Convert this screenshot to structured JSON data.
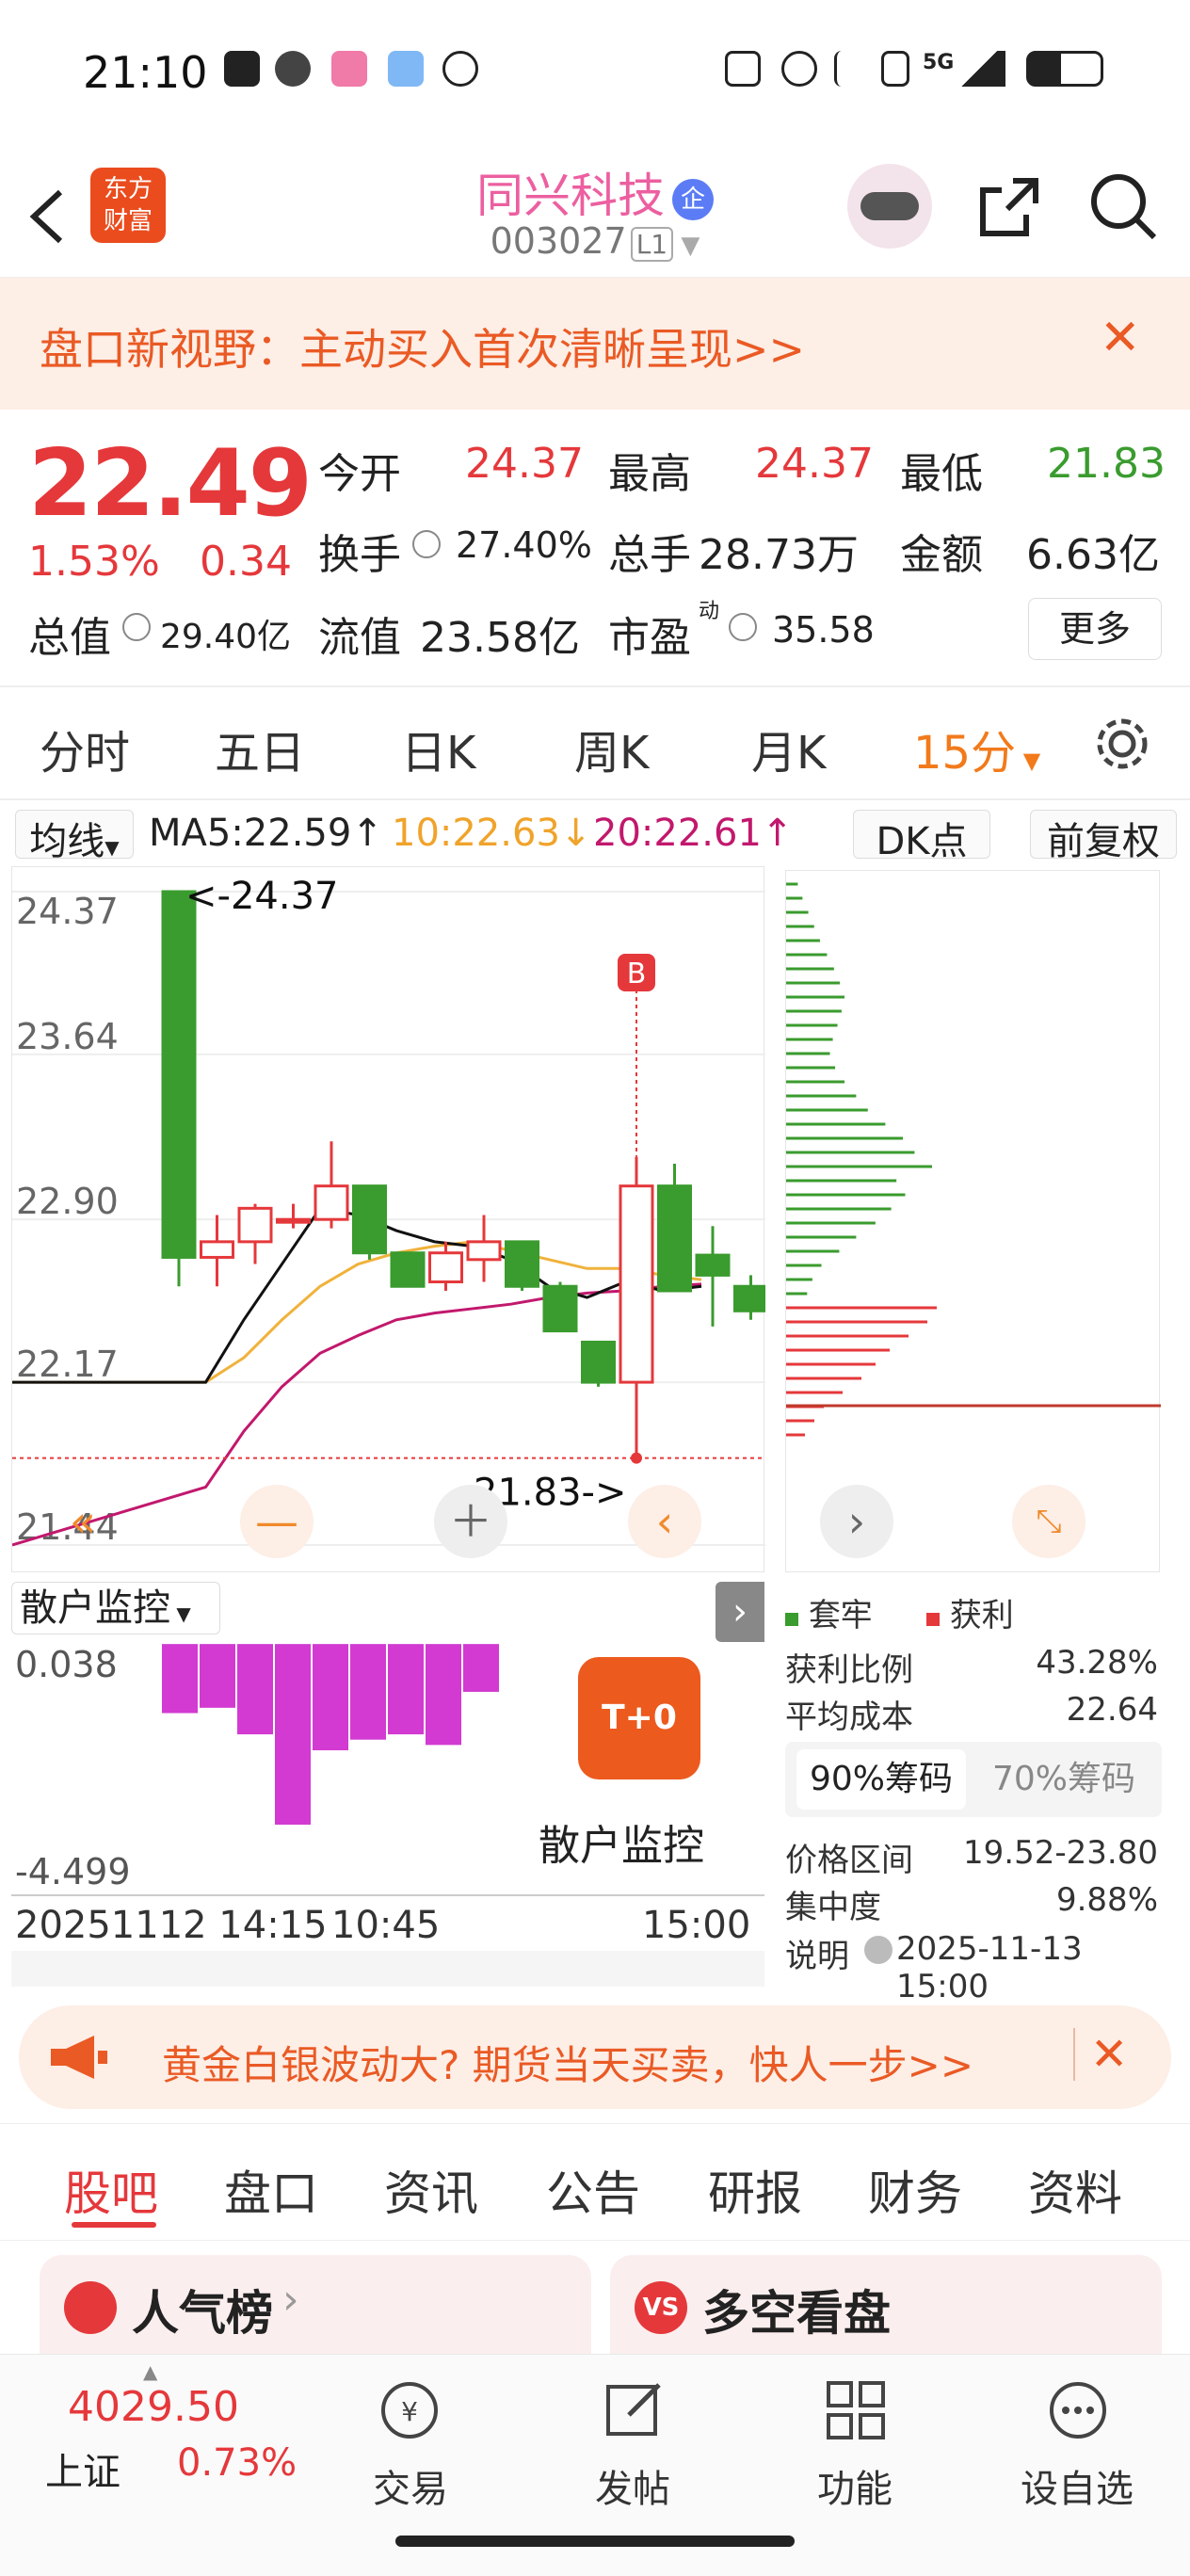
{
  "status_bar": {
    "time": "21:10",
    "network": "5G",
    "icons": [
      "upload-icon",
      "wechat-icon",
      "bilibili-icon",
      "weather-icon",
      "hand-icon",
      "nfc-icon",
      "alarm-icon",
      "bluetooth-icon",
      "vibrate-icon",
      "signal-icon",
      "battery-icon"
    ]
  },
  "header": {
    "stock_name": "同兴科技",
    "badge": "企",
    "stock_code": "003027",
    "level": "L1",
    "logo_line1": "东方",
    "logo_line2": "财富"
  },
  "banner": {
    "text": "盘口新视野：主动买入首次清晰呈现>>",
    "close": "✕"
  },
  "quote": {
    "price": "22.49",
    "change_pct": "1.53%",
    "change": "0.34",
    "open_label": "今开",
    "open": "24.37",
    "high_label": "最高",
    "high": "24.37",
    "low_label": "最低",
    "low": "21.83",
    "turnover_label": "换手",
    "turnover": "27.40%",
    "volume_label": "总手",
    "volume": "28.73万",
    "amount_label": "金额",
    "amount": "6.63亿",
    "mktcap_label": "总值",
    "mktcap": "29.40亿",
    "float_label": "流值",
    "float": "23.58亿",
    "pe_label": "市盈",
    "pe_sup": "动",
    "pe": "35.58",
    "more": "更多"
  },
  "kline_tabs": [
    "分时",
    "五日",
    "日K",
    "周K",
    "月K"
  ],
  "kline_active": "15分",
  "ma_row": {
    "selector": "均线",
    "ma5": "MA5:22.59↑",
    "ma10": "10:22.63↓",
    "ma20": "20:22.61↑",
    "dk": "DK点",
    "adjust": "前复权"
  },
  "chart_data": {
    "type": "candlestick",
    "y_ticks": [
      "24.37",
      "23.64",
      "22.90",
      "22.17",
      "21.44"
    ],
    "ylim": [
      21.44,
      24.37
    ],
    "high_marker": "<-24.37",
    "low_marker": "21.83->",
    "buy_marker": "B",
    "x_labels": [
      "20251112 14:15",
      "10:45",
      "15:00"
    ],
    "candles": [
      {
        "o": 24.37,
        "h": 24.37,
        "l": 22.6,
        "c": 22.73
      },
      {
        "o": 22.73,
        "h": 22.92,
        "l": 22.6,
        "c": 22.8
      },
      {
        "o": 22.8,
        "h": 22.97,
        "l": 22.7,
        "c": 22.95
      },
      {
        "o": 22.9,
        "h": 22.97,
        "l": 22.86,
        "c": 22.9
      },
      {
        "o": 22.9,
        "h": 23.25,
        "l": 22.86,
        "c": 23.05
      },
      {
        "o": 23.05,
        "h": 23.05,
        "l": 22.72,
        "c": 22.75
      },
      {
        "o": 22.75,
        "h": 22.75,
        "l": 22.6,
        "c": 22.6
      },
      {
        "o": 22.62,
        "h": 22.8,
        "l": 22.58,
        "c": 22.75
      },
      {
        "o": 22.72,
        "h": 22.92,
        "l": 22.62,
        "c": 22.8
      },
      {
        "o": 22.8,
        "h": 22.8,
        "l": 22.58,
        "c": 22.6
      },
      {
        "o": 22.6,
        "h": 22.62,
        "l": 22.4,
        "c": 22.4
      },
      {
        "o": 22.35,
        "h": 22.35,
        "l": 22.15,
        "c": 22.17
      },
      {
        "o": 22.17,
        "h": 23.18,
        "l": 21.83,
        "c": 23.05
      },
      {
        "o": 23.05,
        "h": 23.15,
        "l": 22.58,
        "c": 22.58
      },
      {
        "o": 22.74,
        "h": 22.87,
        "l": 22.42,
        "c": 22.65
      },
      {
        "o": 22.6,
        "h": 22.65,
        "l": 22.45,
        "c": 22.49
      }
    ],
    "ma5": [
      22.17,
      22.17,
      22.45,
      22.7,
      22.95,
      22.92,
      22.85,
      22.8,
      22.78,
      22.72,
      22.6,
      22.55,
      22.62,
      22.58,
      22.6
    ],
    "ma10": [
      22.17,
      22.17,
      22.28,
      22.45,
      22.6,
      22.7,
      22.75,
      22.78,
      22.8,
      22.76,
      22.72,
      22.68,
      22.68,
      22.65,
      22.63
    ],
    "ma20": [
      21.44,
      21.7,
      21.95,
      22.15,
      22.3,
      22.38,
      22.45,
      22.48,
      22.5,
      22.52,
      22.55,
      22.57,
      22.58,
      22.6,
      22.61
    ],
    "legend": [
      {
        "name": "套牢",
        "color": "#3a9b2e"
      },
      {
        "name": "获利",
        "color": "#e5383b"
      }
    ]
  },
  "sub_chart": {
    "selector": "散户监控",
    "ytop": "0.038",
    "ybottom": "-4.499",
    "bars": [
      -1.3,
      -1.2,
      -1.7,
      -3.4,
      -2.0,
      -1.8,
      -1.7,
      -1.9,
      -0.9
    ],
    "promo": "散户监控",
    "promo_icon": "T+0"
  },
  "chip_info": {
    "profit_ratio_label": "获利比例",
    "profit_ratio": "43.28%",
    "avg_cost_label": "平均成本",
    "avg_cost": "22.64",
    "tab_active": "90%筹码",
    "tab_other": "70%筹码",
    "range_label": "价格区间",
    "range": "19.52-23.80",
    "concentration_label": "集中度",
    "concentration": "9.88%",
    "note_label": "说明",
    "note_time": "2025-11-13 15:00"
  },
  "ad": {
    "text": "黄金白银波动大? 期货当天买卖，快人一步>>"
  },
  "bottom_tabs": [
    "股吧",
    "盘口",
    "资讯",
    "公告",
    "研报",
    "财务",
    "资料"
  ],
  "cards": [
    {
      "title": "人气榜"
    },
    {
      "title": "多空看盘"
    }
  ],
  "bottom_nav": {
    "index_value": "4029.50",
    "index_name": "上证",
    "index_change": "0.73%",
    "items": [
      "交易",
      "发帖",
      "功能",
      "设自选"
    ]
  }
}
